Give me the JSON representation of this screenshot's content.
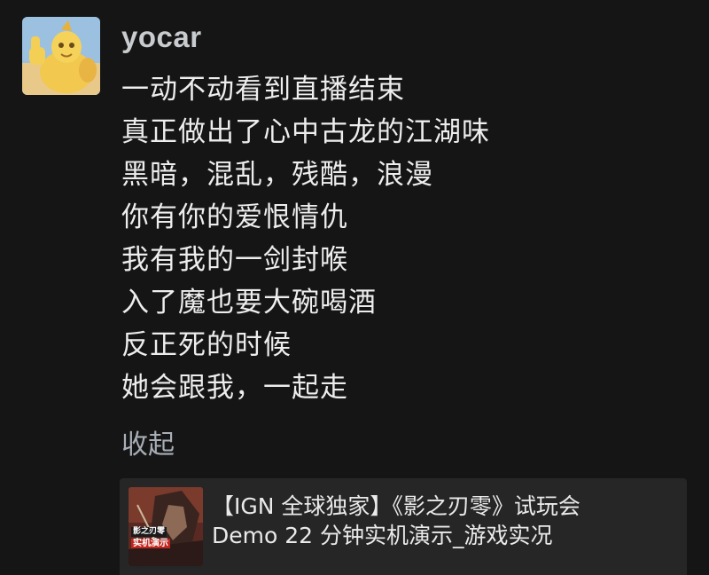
{
  "comment": {
    "username": "yocar",
    "lines": [
      "一动不动看到直播结束",
      "真正做出了心中古龙的江湖味",
      "黑暗，混乱，残酷，浪漫",
      "你有你的爱恨情仇",
      "我有我的一剑封喉",
      "入了魔也要大碗喝酒",
      "反正死的时候",
      "她会跟我，一起走"
    ],
    "collapse_label": "收起"
  },
  "video_card": {
    "title_line1": "【IGN 全球独家】《影之刃零》试玩会",
    "title_line2": "Demo 22 分钟实机演示_游戏实况",
    "thumbnail_caption_1": "影之刃零",
    "thumbnail_caption_2": "实机演示"
  },
  "colors": {
    "background": "#151515",
    "username": "#c9cccf",
    "body_text": "#ededed",
    "link": "#a8aeb6",
    "card_background": "#262626"
  }
}
